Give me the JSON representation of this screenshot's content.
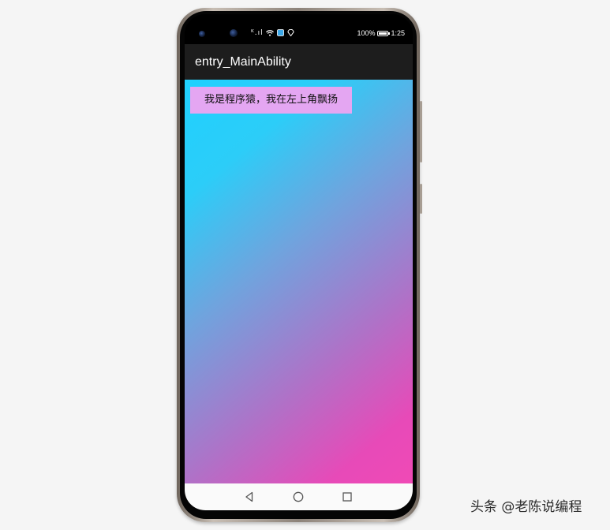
{
  "status_bar": {
    "signal_text": "ᴷ.ıl",
    "icons": [
      "signal-icon",
      "wifi-icon",
      "notification-icon",
      "location-icon"
    ],
    "battery_percent": "100%",
    "battery_level": 1.0,
    "time": "1:25"
  },
  "app_bar": {
    "title": "entry_MainAbility",
    "background": "#1d1d1d"
  },
  "content": {
    "floating_text": "我是程序猿，我在左上角飘扬",
    "floating_text_bg": "#e4a6f2",
    "gradient_colors": [
      "#1fd1ff",
      "#f04ab6"
    ]
  },
  "nav_bar": {
    "icons": [
      "back-icon",
      "home-icon",
      "recent-apps-icon"
    ]
  },
  "watermark": {
    "text": "头条 @老陈说编程"
  }
}
